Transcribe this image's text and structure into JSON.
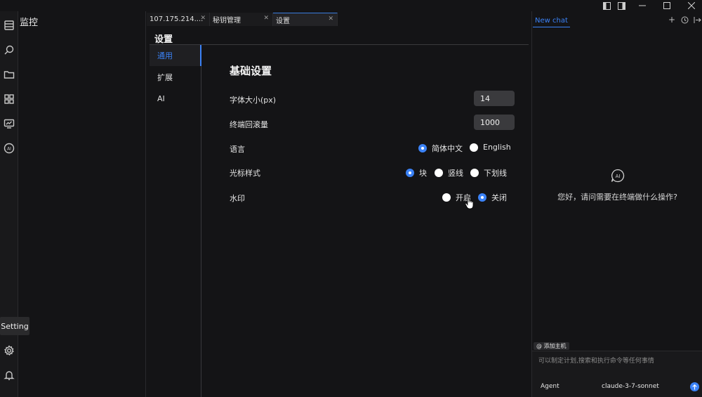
{
  "colors": {
    "accent": "#3b82f6",
    "background": "#141416"
  },
  "window": {
    "controls": [
      "toggle-left-panel-icon",
      "toggle-right-panel-icon",
      "minimize-icon",
      "maximize-icon",
      "close-icon"
    ]
  },
  "activity_bar": {
    "icons": [
      "hosts-list-icon",
      "search-icon",
      "folder-icon",
      "apps-icon",
      "monitor-icon",
      "ai-icon",
      "gear-icon",
      "bell-icon"
    ],
    "tooltip": "Setting"
  },
  "left_panel": {
    "title": "监控"
  },
  "tabs": [
    {
      "label": "107.175.214....",
      "active": false
    },
    {
      "label": "秘钥管理",
      "active": false
    },
    {
      "label": "设置",
      "active": true
    }
  ],
  "settings": {
    "title": "设置",
    "nav": [
      {
        "label": "通用",
        "active": true
      },
      {
        "label": "扩展",
        "active": false
      },
      {
        "label": "AI",
        "active": false
      }
    ],
    "section_title": "基础设置",
    "font_size": {
      "label": "字体大小(px)",
      "value": "14"
    },
    "scrollback": {
      "label": "终端回滚量",
      "value": "1000"
    },
    "language": {
      "label": "语言",
      "options": [
        "简体中文",
        "English"
      ],
      "selected": "简体中文"
    },
    "cursor_style": {
      "label": "光标样式",
      "options": [
        "块",
        "竖线",
        "下划线"
      ],
      "selected": "块"
    },
    "watermark": {
      "label": "水印",
      "options": [
        "开启",
        "关闭"
      ],
      "selected": "关闭"
    }
  },
  "chat": {
    "tab_label": "New chat",
    "tools": [
      "plus-icon",
      "history-icon",
      "collapse-icon"
    ],
    "welcome": "您好，请问需要在终端做什么操作?",
    "mention_chip": "@ 添加主机",
    "input_placeholder": "可以制定计划,搜索和执行命令等任何事情",
    "mode": "Agent",
    "model": "claude-3-7-sonnet",
    "send_icon": "arrow-up-icon"
  }
}
